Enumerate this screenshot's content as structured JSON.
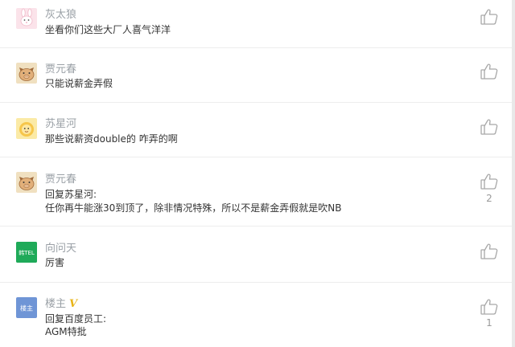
{
  "comments": [
    {
      "name": "灰太狼",
      "lines": [
        "坐看你们这些大厂人喜气洋洋"
      ],
      "likes": ""
    },
    {
      "name": "贾元春",
      "lines": [
        "只能说薪金弄假"
      ],
      "likes": ""
    },
    {
      "name": "苏星河",
      "lines": [
        "那些说薪资double的 咋弄的啊"
      ],
      "likes": ""
    },
    {
      "name": "贾元春",
      "lines": [
        "回复苏星河:",
        "任你再牛能涨30到顶了，除非情况特殊，所以不是薪金弄假就是吹NB"
      ],
      "likes": "2"
    },
    {
      "name": "向问天",
      "lines": [
        "厉害"
      ],
      "likes": "",
      "avatar_text": "韩TEL"
    },
    {
      "name": "楼主",
      "badge": "V",
      "lines": [
        "回复百度员工:",
        "AGM特批"
      ],
      "likes": "1",
      "avatar_text": "楼主"
    }
  ],
  "colors": {
    "name": "#9aa0a6",
    "text": "#333333",
    "like_icon": "#a8a8a8",
    "vip_badge": "#e8b418"
  }
}
